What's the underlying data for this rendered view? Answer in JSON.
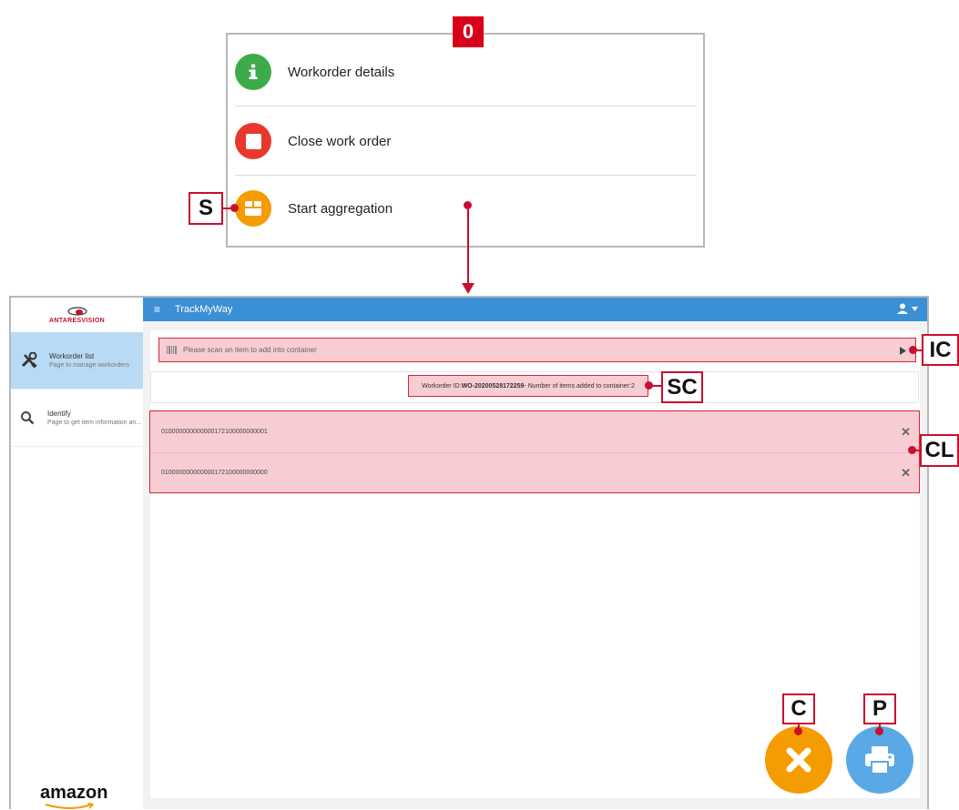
{
  "popup": {
    "badge": "0",
    "items": [
      {
        "label": "Workorder details",
        "icon": "info-icon",
        "color": "#3dab4a"
      },
      {
        "label": "Close work order",
        "icon": "stop-icon",
        "color": "#e8382e"
      },
      {
        "label": "Start aggregation",
        "icon": "box-icon",
        "color": "#f59c00"
      }
    ]
  },
  "callouts": {
    "s": "S",
    "ic": "IC",
    "sc": "SC",
    "cl": "CL",
    "c": "C",
    "p": "P"
  },
  "app": {
    "logo_text": "ANTARESVISION",
    "title": "TrackMyWay",
    "sidebar": [
      {
        "title": "Workorder list",
        "subtitle": "Page to manage workorders",
        "icon": "tools-icon",
        "active": true
      },
      {
        "title": "Identify",
        "subtitle": "Page to get item information an...",
        "icon": "search-icon",
        "active": false
      }
    ],
    "footer_logo": "amazon",
    "scan_placeholder": "Please scan an item to add into container",
    "status": {
      "prefix": "Workorder ID: ",
      "workorder_id": "WO-20200528172259",
      "middle": " - Number of items added to container: ",
      "count": "2"
    },
    "items": [
      "010000000000000172100000000001",
      "010000000000000172100000000000"
    ],
    "cancel_color": "#f59c00",
    "print_color": "#5aa9e6",
    "accent": "#3b8fd4"
  }
}
